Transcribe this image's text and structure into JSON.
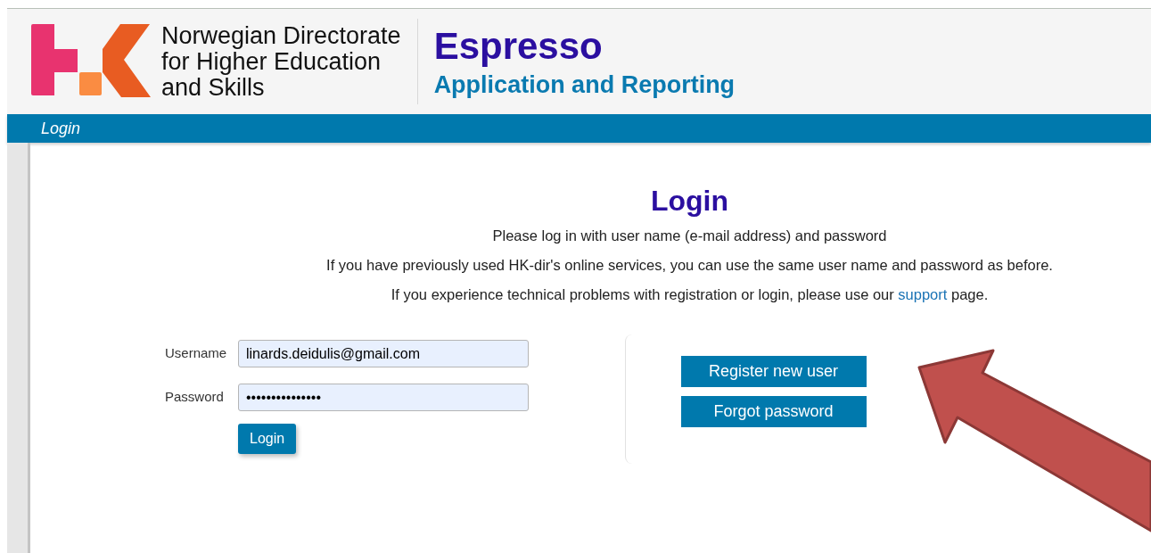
{
  "header": {
    "org_name": [
      "Norwegian Directorate",
      "for Higher Education",
      "and Skills"
    ],
    "app_title": "Espresso",
    "app_subtitle": "Application and Reporting"
  },
  "nav": {
    "items": [
      {
        "label": "Login"
      }
    ]
  },
  "login": {
    "title": "Login",
    "intro": [
      "Please log in with user name (e-mail address) and password",
      "If you have previously used HK-dir's online services, you can use the same user name and password as before."
    ],
    "support_line": {
      "before": "If you experience technical problems with registration or login, please use our",
      "link": "support",
      "after": "page."
    },
    "fields": [
      {
        "label": "Username",
        "value": "linards.deidulis@gmail.com"
      },
      {
        "label": "Password",
        "value": "•••••••••••••••"
      }
    ],
    "submit": "Login",
    "actions": [
      "Register new user",
      "Forgot password"
    ]
  },
  "annotation": {
    "kind": "arrow"
  }
}
